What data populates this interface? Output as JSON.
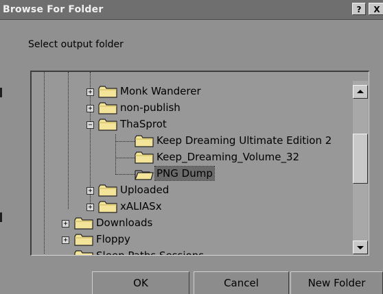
{
  "window": {
    "title": "Browse For Folder",
    "help_label": "?",
    "close_label": "X"
  },
  "prompt": "Select output folder",
  "tree": {
    "items": [
      {
        "label": "Monk Wanderer",
        "expander": "+"
      },
      {
        "label": "non-publish",
        "expander": "+"
      },
      {
        "label": "ThaSprot",
        "expander": "−"
      },
      {
        "label": "Keep Dreaming Ultimate Edition 2"
      },
      {
        "label": "Keep_Dreaming_Volume_32"
      },
      {
        "label": "PNG Dump",
        "selected": true
      },
      {
        "label": "Uploaded",
        "expander": "+"
      },
      {
        "label": "xALIASx",
        "expander": "+"
      },
      {
        "label": "Downloads",
        "expander": "+"
      },
      {
        "label": "Floppy",
        "expander": "+"
      },
      {
        "label": "Sleep Paths Sessions"
      }
    ]
  },
  "buttons": {
    "ok": "OK",
    "cancel": "Cancel",
    "new_folder": "New Folder"
  },
  "colors": {
    "dialog_bg": "#909090",
    "titlebar": "#6f6f6f",
    "selection": "#6b6b6b",
    "folder_fill": "#f4e49a"
  }
}
